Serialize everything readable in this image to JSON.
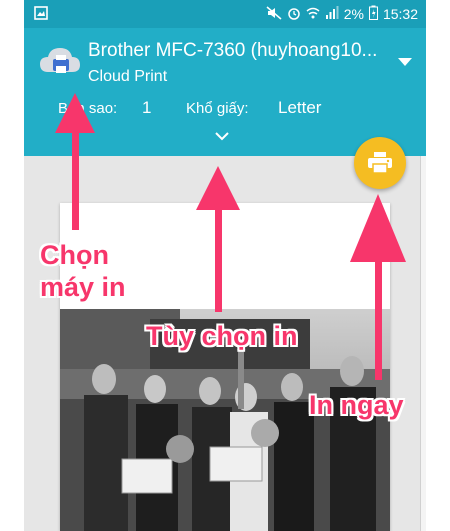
{
  "status_bar": {
    "battery_percent": "2%",
    "time": "15:32"
  },
  "header": {
    "printer_name": "Brother MFC-7360 (huyhoang10...",
    "printer_subtitle": "Cloud Print",
    "copies_label": "Bản sao:",
    "copies_value": "1",
    "paper_label": "Khổ giấy:",
    "paper_value": "Letter"
  },
  "annotations": {
    "choose_printer": "Chọn máy in",
    "print_options": "Tùy chọn in",
    "print_now": "In ngay"
  },
  "colors": {
    "header": "#22aec7",
    "status_bar": "#1a9fb8",
    "fab": "#f5bd22",
    "annotation": "#f7366b"
  },
  "icons": [
    "image-notification-icon",
    "mute-icon",
    "alarm-icon",
    "wifi-icon",
    "signal-icon",
    "battery-icon",
    "cloud-print-icon",
    "dropdown-arrow-icon",
    "expand-chevron-icon",
    "print-icon"
  ]
}
